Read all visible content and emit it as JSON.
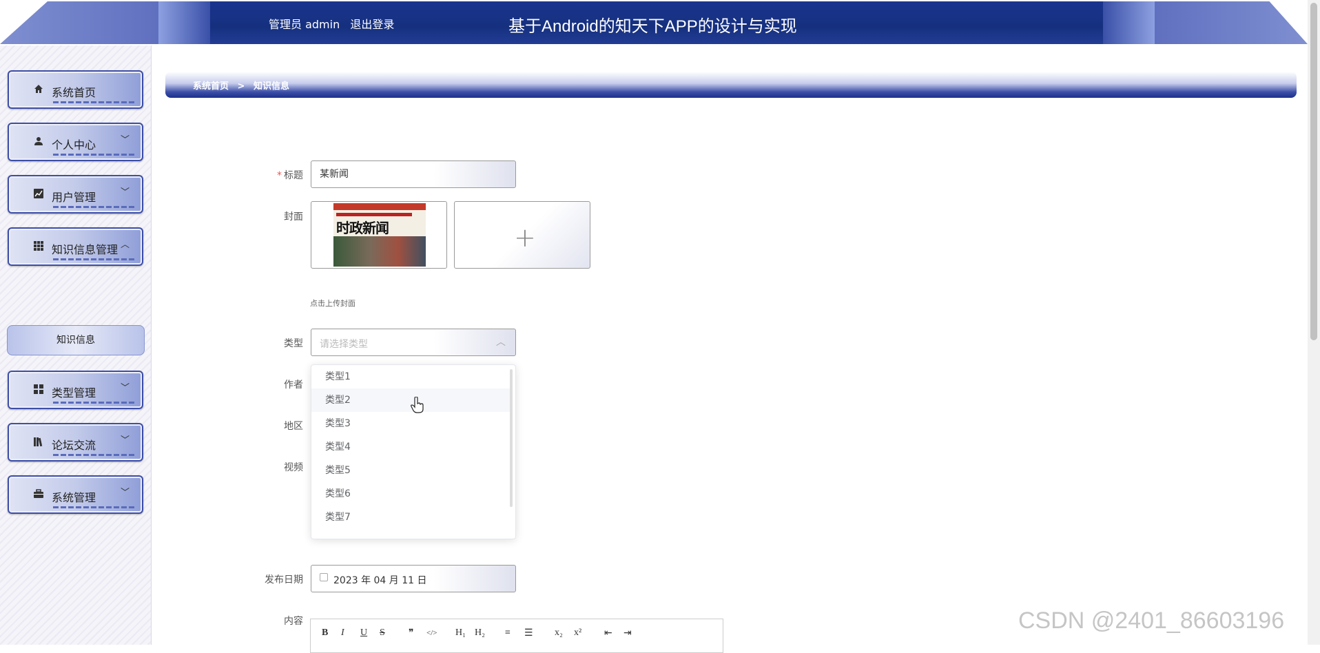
{
  "header": {
    "user_role": "管理员 admin",
    "logout_label": "退出登录",
    "title": "基于Android的知天下APP的设计与实现"
  },
  "sidebar": {
    "items": [
      {
        "label": "系统首页",
        "icon": "home-icon",
        "expanded": false
      },
      {
        "label": "个人中心",
        "icon": "user-icon",
        "expanded": false
      },
      {
        "label": "用户管理",
        "icon": "chart-icon",
        "expanded": false
      },
      {
        "label": "知识信息管理",
        "icon": "grid-icon",
        "expanded": true
      },
      {
        "label": "类型管理",
        "icon": "apps-icon",
        "expanded": false
      },
      {
        "label": "论坛交流",
        "icon": "books-icon",
        "expanded": false
      },
      {
        "label": "系统管理",
        "icon": "briefcase-icon",
        "expanded": false
      }
    ],
    "submenu": {
      "label": "知识信息"
    }
  },
  "breadcrumb": {
    "home": "系统首页",
    "separator": ">",
    "current": "知识信息"
  },
  "form": {
    "title_label": "标题",
    "title_value": "某新闻",
    "cover_label": "封面",
    "cover_image_text": "时政新闻",
    "cover_hint": "点击上传封面",
    "type_label": "类型",
    "type_placeholder": "请选择类型",
    "author_label": "作者",
    "region_label": "地区",
    "video_label": "视频",
    "date_label": "发布日期",
    "date_value": "2023 年 04 月 11 日",
    "content_label": "内容"
  },
  "type_dropdown": {
    "options": [
      "类型1",
      "类型2",
      "类型3",
      "类型4",
      "类型5",
      "类型6",
      "类型7"
    ],
    "hovered": "类型2"
  },
  "editor_toolbar": [
    "B",
    "I",
    "U",
    "S",
    "❞",
    "</>",
    "H₁",
    "H₂",
    "≡",
    "☰",
    "x₂",
    "x²",
    "⇤",
    "⇥"
  ],
  "watermark": "CSDN @2401_86603196",
  "colors": {
    "header_blue": "#16307f",
    "menu_border": "#3d4ea6",
    "required_star": "#e55"
  }
}
